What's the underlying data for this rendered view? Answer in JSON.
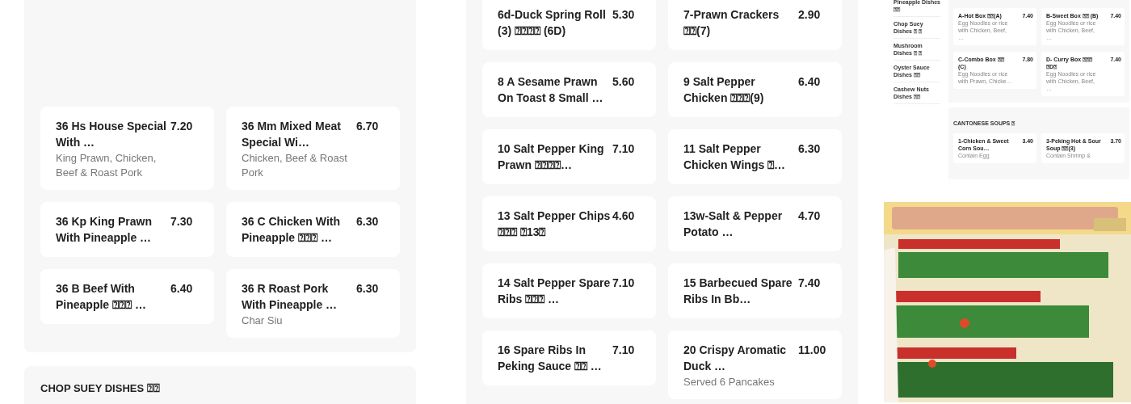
{
  "left_section": {
    "items": [
      {
        "name": "36 Hs House Special With …",
        "price": "7.20",
        "description": "King Prawn, Chicken, Beef & Roast Pork"
      },
      {
        "name": "36 Mm Mixed Meat Special Wi…",
        "price": "6.70",
        "description": "Chicken, Beef & Roast Pork"
      },
      {
        "name": "36 Kp King Prawn With Pineapple …",
        "price": "7.30"
      },
      {
        "name": "36 C Chicken With Pineapple ⍰⍰⍰ …",
        "price": "6.30"
      },
      {
        "name": "36 B Beef With Pineapple ⍰⍰⍰ …",
        "price": "6.40"
      },
      {
        "name": "36 R Roast Pork With Pineapple …",
        "price": "6.30",
        "description": "Char Siu"
      }
    ]
  },
  "next_section": {
    "title": "CHOP SUEY DISHES ⍰⍰"
  },
  "middle_section": {
    "items": [
      {
        "name": "6d-Duck Spring Roll (3) ⍰⍰⍰⍰ (6D)",
        "price": "5.30"
      },
      {
        "name": "7-Prawn Crackers ⍰⍰(7)",
        "price": "2.90"
      },
      {
        "name": "8 A Sesame Prawn On Toast 8 Small …",
        "price": "5.60"
      },
      {
        "name": "9 Salt Pepper Chicken ⍰⍰⍰(9)",
        "price": "6.40"
      },
      {
        "name": "10 Salt Pepper King Prawn ⍰⍰⍰⍰…",
        "price": "7.10"
      },
      {
        "name": "11 Salt Pepper Chicken Wings ⍰…",
        "price": "6.30"
      },
      {
        "name": "13 Salt Pepper Chips ⍰⍰⍰ ⍰13⍰",
        "price": "4.60"
      },
      {
        "name": "13w-Salt & Pepper Potato …",
        "price": "4.70"
      },
      {
        "name": "14 Salt Pepper Spare Ribs ⍰⍰⍰ …",
        "price": "7.10"
      },
      {
        "name": "15 Barbecued Spare Ribs In Bb…",
        "price": "7.40"
      },
      {
        "name": "16 Spare Ribs In Peking Sauce ⍰⍰ …",
        "price": "7.10"
      },
      {
        "name": "20 Crispy Aromatic Duck …",
        "price": "11.00",
        "description": "Served 6 Pancakes"
      }
    ]
  },
  "preview": {
    "sidebar": [
      "Pineapple Dishes ⍰⍰",
      "Chop Suey Dishes ⍰ ⍰",
      "Mushroom Dishes ⍰ ⍰",
      "Oyster Sauce Dishes ⍰⍰",
      "Cashew Nuts Dishes ⍰⍰"
    ],
    "sections": [
      {
        "items": [
          {
            "name": "A-Hot Box ⍰⍰(A)",
            "price": "7.40",
            "description": "Egg Noodles or rice with Chicken, Beef, …"
          },
          {
            "name": "B-Sweet Box ⍰⍰ (B)",
            "price": "7.40",
            "description": "Egg Noodles or rice with Chicken, Beef, …"
          },
          {
            "name": "C-Combo Box ⍰⍰ (C)",
            "price": "7.80",
            "description": "Egg Noodles or rice with Prawn, Chicke…"
          },
          {
            "name": "D- Curry Box ⍰⍰⍰ ⍰D⍰",
            "price": "7.40",
            "description": "Egg Noodles or rice with Chicken, Beef, …"
          }
        ]
      },
      {
        "title": "CANTONESE SOUPS ⍰",
        "items": [
          {
            "name": "1-Chicken & Sweet Corn Sou…",
            "price": "3.40",
            "description": "Contain Egg"
          },
          {
            "name": "3-Peking Hot & Sour Soup ⍰⍰(3)",
            "price": "3.70",
            "description": "Contain Shrimp &"
          }
        ]
      }
    ]
  }
}
